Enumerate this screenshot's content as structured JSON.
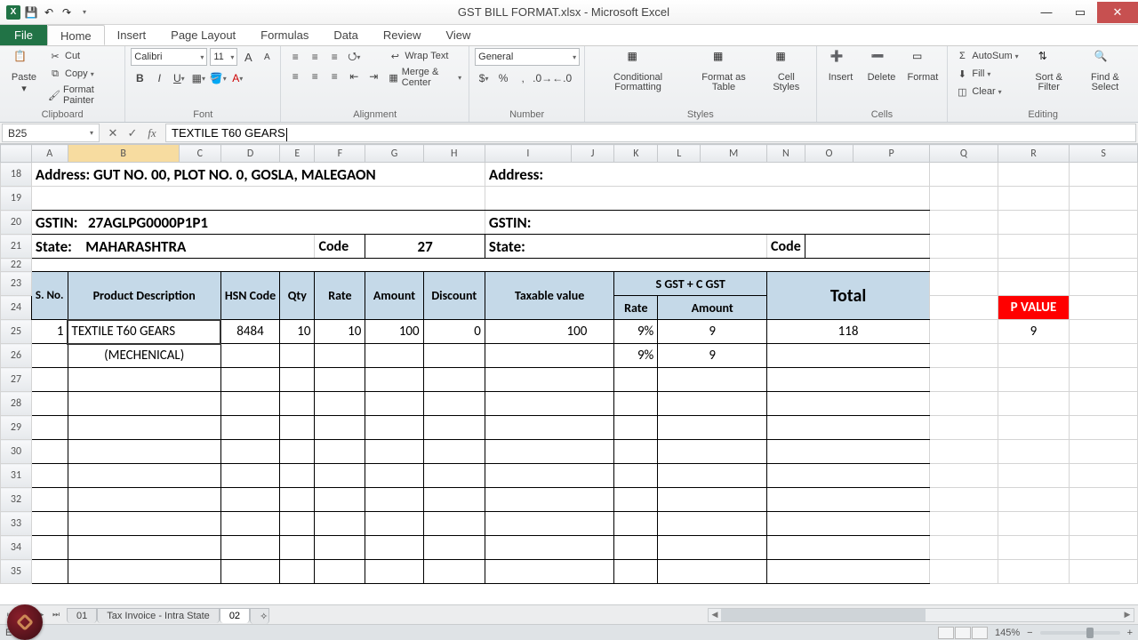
{
  "window": {
    "title": "GST BILL FORMAT.xlsx - Microsoft Excel"
  },
  "menu": {
    "file": "File",
    "home": "Home",
    "insert": "Insert",
    "pagelayout": "Page Layout",
    "formulas": "Formulas",
    "data": "Data",
    "review": "Review",
    "view": "View"
  },
  "ribbon": {
    "clipboard": {
      "paste": "Paste",
      "cut": "Cut",
      "copy": "Copy",
      "fmt": "Format Painter",
      "label": "Clipboard"
    },
    "font": {
      "name": "Calibri",
      "size": "11",
      "label": "Font"
    },
    "align": {
      "wrap": "Wrap Text",
      "merge": "Merge & Center",
      "label": "Alignment"
    },
    "number": {
      "fmt": "General",
      "label": "Number"
    },
    "styles": {
      "cond": "Conditional Formatting",
      "table": "Format as Table",
      "cell": "Cell Styles",
      "label": "Styles"
    },
    "cells": {
      "insert": "Insert",
      "delete": "Delete",
      "format": "Format",
      "label": "Cells"
    },
    "editing": {
      "sum": "AutoSum",
      "fill": "Fill",
      "clear": "Clear",
      "sort": "Sort & Filter",
      "find": "Find & Select",
      "label": "Editing"
    }
  },
  "namebox": "B25",
  "formula": "TEXTILE T60 GEARS",
  "columns": [
    "A",
    "B",
    "C",
    "D",
    "E",
    "F",
    "G",
    "H",
    "I",
    "J",
    "K",
    "L",
    "M",
    "N",
    "O",
    "P",
    "Q",
    "R",
    "S"
  ],
  "rows": [
    "18",
    "19",
    "20",
    "21",
    "22",
    "23",
    "24",
    "25",
    "26",
    "27",
    "28",
    "29",
    "30",
    "31",
    "32",
    "33",
    "34",
    "35"
  ],
  "data": {
    "r18_addr_lbl": "Address: GUT NO. 00, PLOT NO. 0, GOSLA, MALEGAON",
    "r18_addr2": "Address:",
    "r20_gstin_lbl": "GSTIN:",
    "r20_gstin_val": "27AGLPG0000P1P1",
    "r20_gstin2": "GSTIN:",
    "r21_state_lbl": "State:",
    "r21_state_val": "MAHARASHTRA",
    "r21_code_lbl": "Code",
    "r21_code_val": "27",
    "r21_state2": "State:",
    "r21_code2": "Code",
    "hdr_sno": "S. No.",
    "hdr_desc": "Product Description",
    "hdr_hsn": "HSN Code",
    "hdr_qty": "Qty",
    "hdr_rate": "Rate",
    "hdr_amt": "Amount",
    "hdr_disc": "Discount",
    "hdr_tax": "Taxable value",
    "hdr_sgst": "S GST  +  C GST",
    "hdr_total": "Total",
    "hdr_grate": "Rate",
    "hdr_gamt": "Amount",
    "pvalue": "P VALUE",
    "r25_sno": "1",
    "r25_desc": "TEXTILE T60 GEARS",
    "r25_hsn": "8484",
    "r25_qty": "10",
    "r25_rate": "10",
    "r25_amt": "100",
    "r25_disc": "0",
    "r25_tax": "100",
    "r25_grate": "9%",
    "r25_gamt": "9",
    "r25_total": "118",
    "r25_pv": "9",
    "r26_desc": "(MECHENICAL)",
    "r26_grate": "9%",
    "r26_gamt": "9"
  },
  "sheets": {
    "s1": "01",
    "s2": "Tax Invoice - Intra State",
    "s3": "02"
  },
  "status": {
    "mode": "Edit",
    "zoom": "145%"
  }
}
